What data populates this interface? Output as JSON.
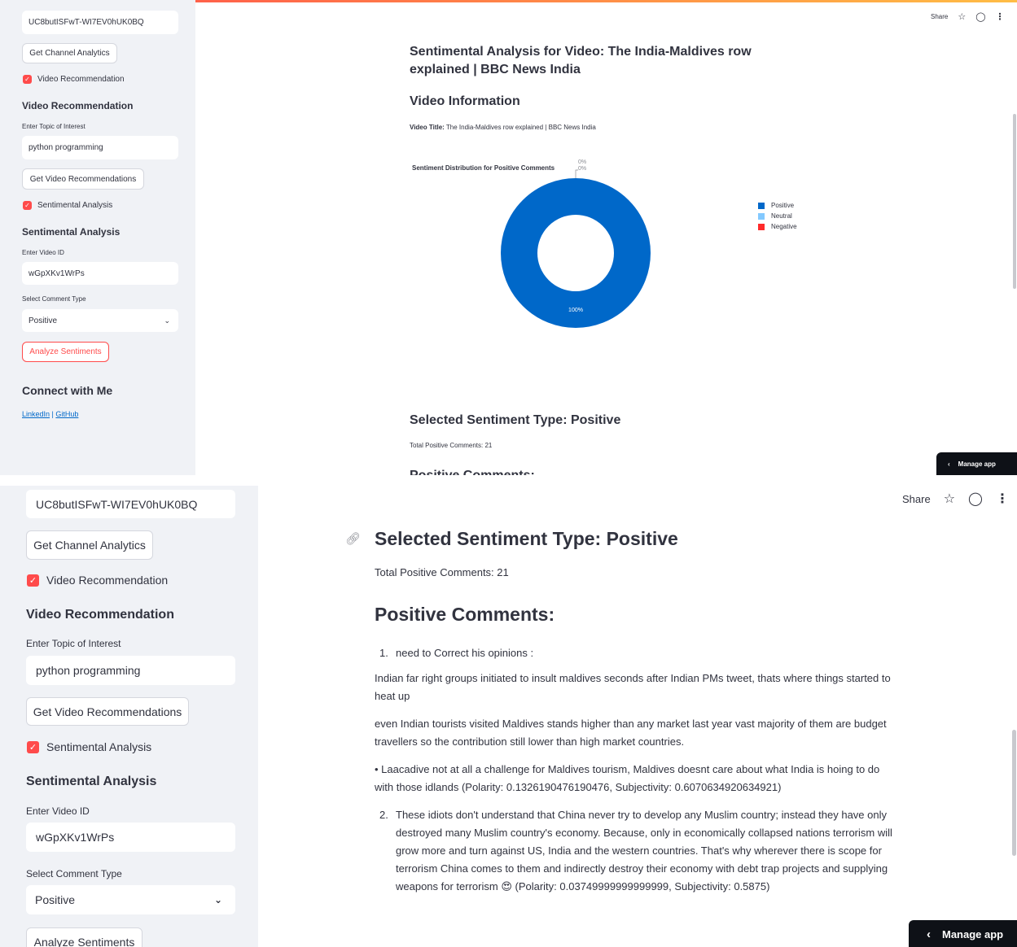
{
  "sidebar": {
    "channel_id_value": "UC8butISFwT-WI7EV0hUK0BQ",
    "get_channel_analytics": "Get Channel Analytics",
    "video_recommendation_checkbox": "Video Recommendation",
    "video_recommendation_heading": "Video Recommendation",
    "topic_label": "Enter Topic of Interest",
    "topic_value": "python programming",
    "get_video_recommendations": "Get Video Recommendations",
    "sentimental_analysis_checkbox": "Sentimental Analysis",
    "sentimental_analysis_heading": "Sentimental Analysis",
    "video_id_label": "Enter Video ID",
    "video_id_value": "wGpXKv1WrPs",
    "comment_type_label": "Select Comment Type",
    "comment_type_selected": "Positive",
    "analyze_sentiments": "Analyze Sentiments",
    "connect_heading": "Connect with Me",
    "linkedin": "LinkedIn",
    "link_separator": " | ",
    "github": "GitHub"
  },
  "toolbar": {
    "share": "Share"
  },
  "manage_app": "Manage app",
  "main": {
    "page_title": "Sentimental Analysis for Video: The India-Maldives row explained | BBC News India",
    "video_info_heading": "Video Information",
    "video_title_label": "Video Title:",
    "video_title_value": " The India-Maldives row explained | BBC News India",
    "selected_type_heading": "Selected Sentiment Type: Positive",
    "total_comments": "Total Positive Comments: 21",
    "comments_heading": "Positive Comments:",
    "comment_1_number": "1.",
    "comment_1_line1": "need to Correct his opinions :",
    "comment_1_para2": "Indian far right groups initiated to insult maldives seconds after Indian PMs tweet, thats where things started to heat up",
    "comment_1_para3": "even Indian tourists visited Maldives stands higher than any market last year vast majority of them are budget travellers so the contribution still lower than high market countries.",
    "comment_1_para4": "• Laacadive not at all a challenge for Maldives tourism, Maldives doesnt care about what India is hoing to do with those idlands (Polarity: 0.1326190476190476, Subjectivity: 0.6070634920634921)",
    "comment_2_number": "2.",
    "comment_2_text": "These idiots don't understand that China never try to develop any Muslim country; instead they have only destroyed many Muslim country's economy. Because, only in economically collapsed nations terrorism will grow more and turn against US, India and the western countries. That's why wherever there is scope for terrorism China comes to them and indirectly destroy their economy with debt trap projects and supplying weapons for terrorism 😍 (Polarity: 0.03749999999999999, Subjectivity: 0.5875)"
  },
  "chart_data": {
    "type": "pie",
    "title": "Sentiment Distribution for Positive Comments",
    "labels": [
      "Positive",
      "Neutral",
      "Negative"
    ],
    "values": [
      100,
      0,
      0
    ],
    "value_labels": [
      "100%",
      "0%",
      "0%"
    ],
    "colors": [
      "#0068c9",
      "#83c9ff",
      "#ff2b2b"
    ],
    "hole": true,
    "legend_position": "right"
  },
  "colors": {
    "accent": "#ff4b4b",
    "link": "#0068c9",
    "sidebar_bg": "#f0f2f6"
  }
}
